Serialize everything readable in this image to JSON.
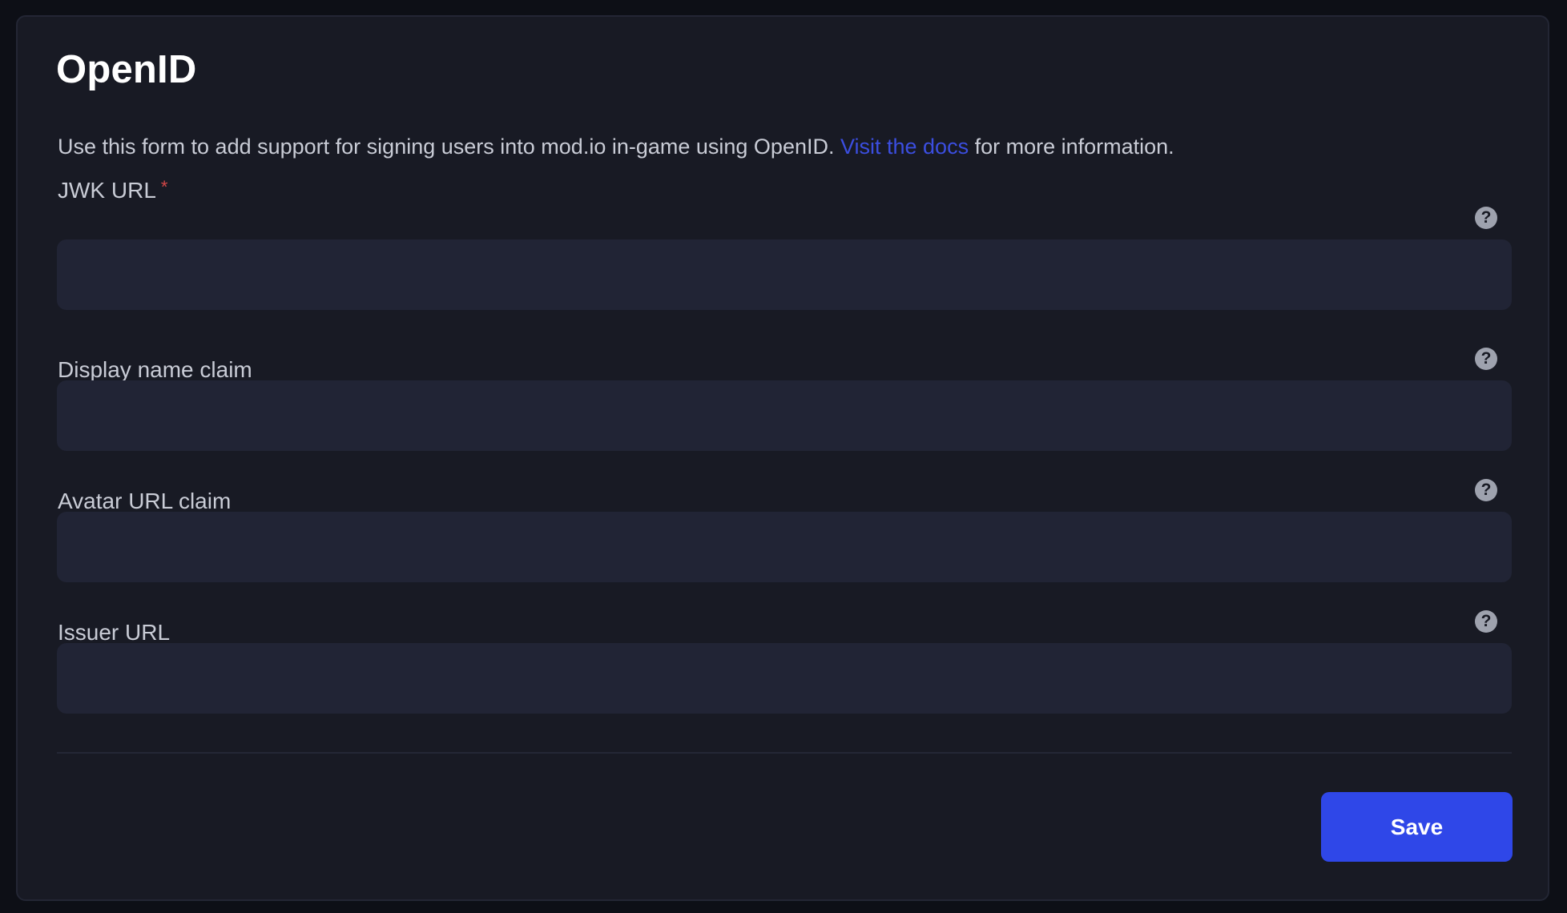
{
  "page": {
    "title": "OpenID",
    "description_before": "Use this form to add support for signing users into mod.io in-game using OpenID. ",
    "description_link": "Visit the docs",
    "description_after": " for more information."
  },
  "fields": [
    {
      "label": "JWK URL",
      "required_mark": "*",
      "value": "",
      "placeholder": ""
    },
    {
      "label": "Display name claim",
      "value": "",
      "placeholder": ""
    },
    {
      "label": "Avatar URL claim",
      "value": "",
      "placeholder": ""
    },
    {
      "label": "Issuer URL",
      "value": "",
      "placeholder": ""
    }
  ],
  "help_icon": {
    "glyph": "?",
    "icon": "question-circle-icon"
  },
  "actions": {
    "save_label": "Save"
  },
  "colors": {
    "accent": "#2f47e8",
    "link": "#3b4ee0",
    "required": "#d64848",
    "card_bg": "#181a24",
    "input_bg": "#212435"
  }
}
